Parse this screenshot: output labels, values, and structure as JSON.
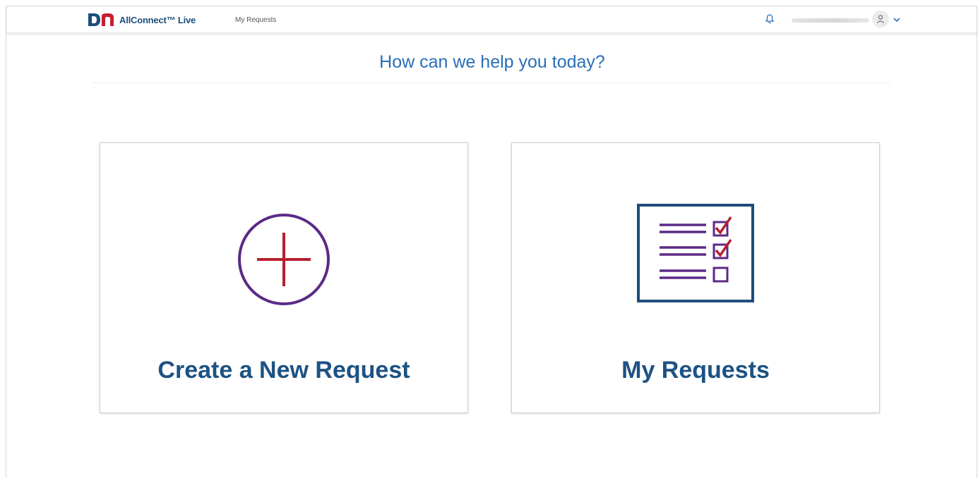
{
  "header": {
    "brand": "AllConnect™ Live",
    "nav_link": "My Requests",
    "icons": {
      "logo": "dn-logo",
      "bell": "bell-icon",
      "avatar": "user-avatar-icon",
      "chevron": "chevron-down-icon"
    }
  },
  "main": {
    "headline": "How can we help you today?",
    "cards": [
      {
        "title": "Create a New Request",
        "icon": "plus-circle-icon"
      },
      {
        "title": "My Requests",
        "icon": "checklist-icon"
      }
    ]
  },
  "colors": {
    "headline": "#2a6fb6",
    "card_title": "#1d5283",
    "purple": "#5b2a86",
    "red": "#b5202e",
    "navy": "#1d4e7b"
  }
}
